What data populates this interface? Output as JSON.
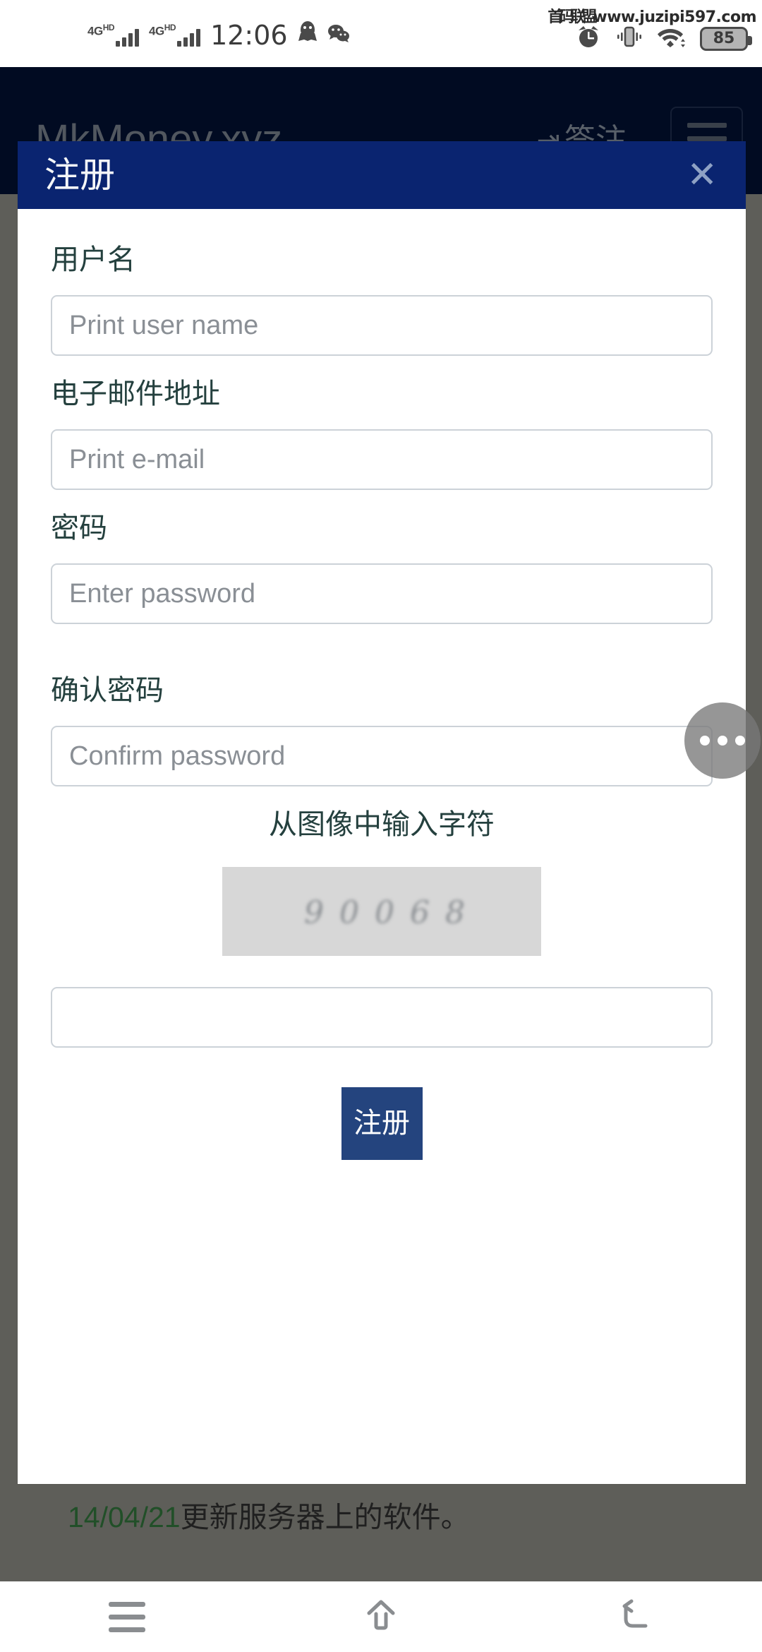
{
  "status_bar": {
    "network_labels": [
      "4G",
      "4G"
    ],
    "network_suffix": "HD",
    "clock": "12:06",
    "qq_icon": "qq-penguin-icon",
    "wechat_icon": "wechat-icon",
    "alarm_icon": "alarm-clock-icon",
    "vibrate_icon": "vibrate-mode-icon",
    "wifi_icon": "wifi-icon",
    "battery_level": "85"
  },
  "watermark": {
    "cn": "首码联盟",
    "url": "www.juzipi597.com"
  },
  "page": {
    "brand": "MkMoney.xyz",
    "signin_label": "签注",
    "signin_icon": "sign-in-arrow-icon",
    "menu_icon": "hamburger-menu-icon",
    "notice_date": "14/04/21",
    "notice_text": "更新服务器上的软件。"
  },
  "modal": {
    "title": "注册",
    "close_label": "✕",
    "fields": [
      {
        "label": "用户名",
        "placeholder": "Print user name",
        "value": "",
        "type": "text",
        "name": "username"
      },
      {
        "label": "电子邮件地址",
        "placeholder": "Print e-mail",
        "value": "",
        "type": "email",
        "name": "email"
      },
      {
        "label": "密码",
        "placeholder": "Enter password",
        "value": "",
        "type": "password",
        "name": "password"
      },
      {
        "label": "确认密码",
        "placeholder": "Confirm password",
        "value": "",
        "type": "password",
        "name": "confirm-password"
      }
    ],
    "captcha": {
      "prompt": "从图像中输入字符",
      "image_code": "90068",
      "input_placeholder": "",
      "input_value": ""
    },
    "submit_label": "注册"
  },
  "float_ball": {
    "icon": "more-dots-icon"
  },
  "nav_bar": {
    "recents_icon": "recents-icon",
    "home_icon": "home-icon",
    "back_icon": "back-icon"
  },
  "colors": {
    "header_navy": "#020f2e",
    "modal_header_blue": "#0a2470",
    "submit_blue": "#24447e",
    "label_green": "#24403e",
    "notice_green": "#1c6b29"
  }
}
